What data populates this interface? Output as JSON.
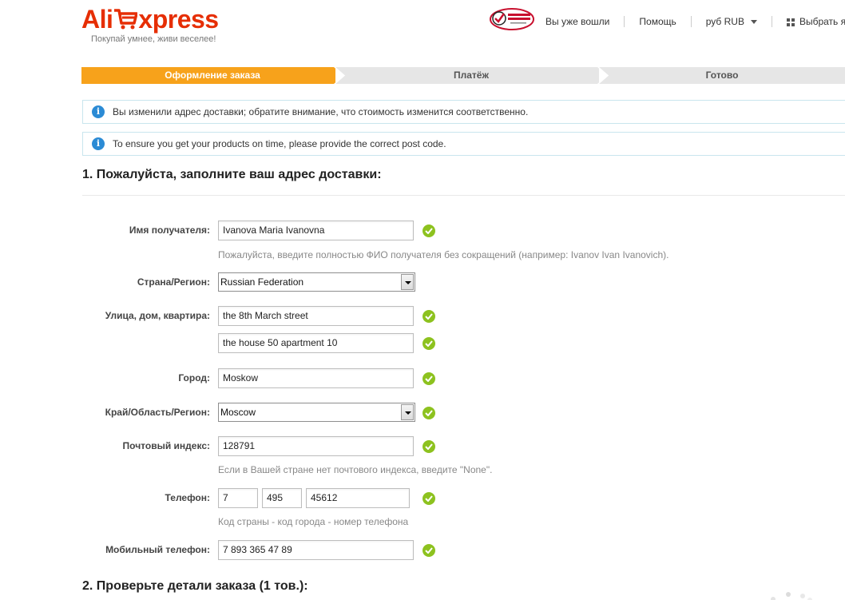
{
  "header": {
    "logo_left": "Ali",
    "logo_right": "xpress",
    "tagline": "Покупай умнее, живи веселее!",
    "nav": {
      "signed_in": "Вы уже вошли",
      "help": "Помощь",
      "currency": "руб RUB",
      "language": "Выбрать язык"
    }
  },
  "steps": [
    {
      "label": "Оформление заказа",
      "active": true
    },
    {
      "label": "Платёж",
      "active": false
    },
    {
      "label": "Готово",
      "active": false
    }
  ],
  "notices": [
    "Вы изменили адрес доставки; обратите внимание, что стоимость изменится соответственно.",
    "To ensure you get your products on time, please provide the correct post code."
  ],
  "section1": {
    "title": "1. Пожалуйста, заполните ваш адрес доставки:"
  },
  "form": {
    "name": {
      "label": "Имя получателя:",
      "value": "Ivanova Maria Ivanovna",
      "hint": "Пожалуйста, введите полностью ФИО получателя без сокращений (например: Ivanov Ivan Ivanovich)."
    },
    "country": {
      "label": "Страна/Регион:",
      "value": "Russian Federation"
    },
    "street": {
      "label": "Улица, дом, квартира:",
      "line1": "the 8th March street",
      "line2": " the house 50 apartment 10"
    },
    "city": {
      "label": "Город:",
      "value": "Moskow"
    },
    "region": {
      "label": "Край/Область/Регион:",
      "value": "Moscow"
    },
    "zip": {
      "label": "Почтовый индекс:",
      "value": "128791",
      "hint": "Если в Вашей стране нет почтового индекса, введите \"None\"."
    },
    "phone": {
      "label": "Телефон:",
      "country_code": "7",
      "city_code": "495",
      "number": "45612",
      "hint": "Код страны - код города - номер телефона"
    },
    "mobile": {
      "label": "Мобильный телефон:",
      "value": "7 893 365 47 89"
    }
  },
  "section2": {
    "title": "2. Проверьте детали заказа (1 тов.):"
  },
  "colors": {
    "brand": "#e62e04",
    "step_active": "#f7a21b",
    "step_inactive": "#e6e6e6",
    "info": "#2b8bd5",
    "check": "#8dc21f"
  }
}
